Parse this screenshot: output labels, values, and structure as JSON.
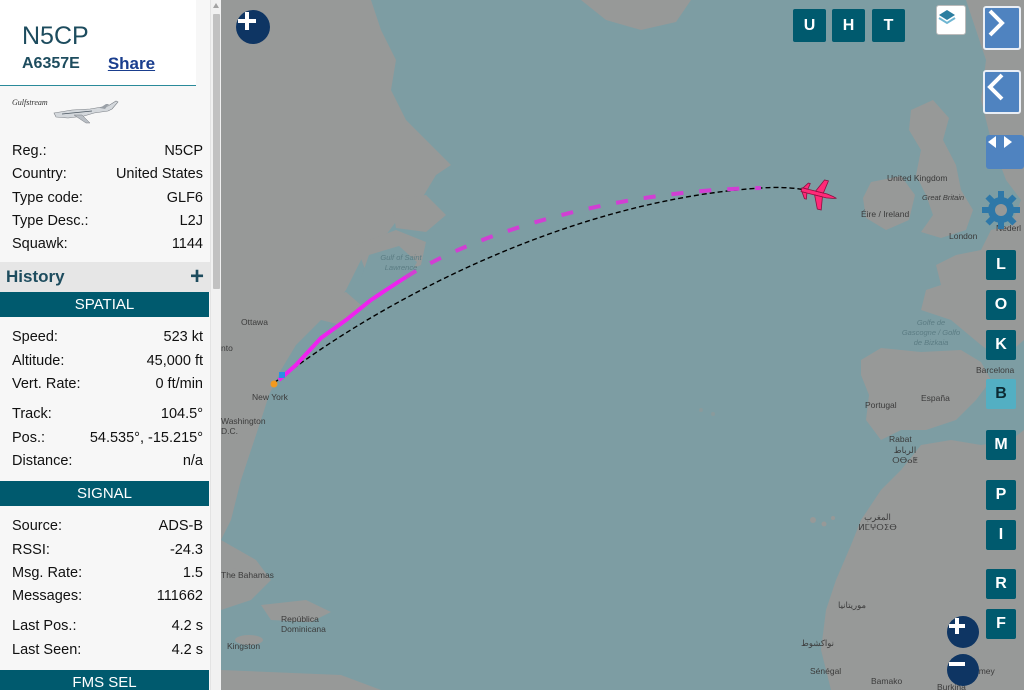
{
  "aircraft": {
    "callsign": "N5CP",
    "icao": "A6357E",
    "share_label": "Share",
    "photo_brand": "Gulfstream",
    "details": [
      {
        "label": "Reg.:",
        "value": "N5CP"
      },
      {
        "label": "Country:",
        "value": "United States"
      },
      {
        "label": "Type code:",
        "value": "GLF6"
      },
      {
        "label": "Type Desc.:",
        "value": "L2J"
      },
      {
        "label": "Squawk:",
        "value": "1144"
      }
    ]
  },
  "history": {
    "label": "History",
    "plus": "+"
  },
  "spatial": {
    "title": "SPATIAL",
    "group1": [
      {
        "label": "Speed:",
        "value": "523 kt"
      },
      {
        "label": "Altitude:",
        "value": "45,000 ft"
      },
      {
        "label": "Vert. Rate:",
        "value": "0 ft/min"
      }
    ],
    "group2": [
      {
        "label": "Track:",
        "value": "104.5°"
      },
      {
        "label": "Pos.:",
        "value": "54.535°, -15.215°"
      },
      {
        "label": "Distance:",
        "value": "n/a"
      }
    ]
  },
  "signal": {
    "title": "SIGNAL",
    "group1": [
      {
        "label": "Source:",
        "value": "ADS-B"
      },
      {
        "label": "RSSI:",
        "value": "-24.3"
      },
      {
        "label": "Msg. Rate:",
        "value": "1.5"
      },
      {
        "label": "Messages:",
        "value": "111662"
      }
    ],
    "group2": [
      {
        "label": "Last Pos.:",
        "value": "4.2 s"
      },
      {
        "label": "Last Seen:",
        "value": "4.2 s"
      }
    ]
  },
  "next_section": {
    "title": "FMS SEL"
  },
  "map": {
    "labels": {
      "united_kingdom": "United Kingdom",
      "great_britain": "Great Britain",
      "eire": "Éire / Ireland",
      "london": "London",
      "nederland": "Nederl",
      "gulf_st_lawrence": "Gulf of Saint Lawrence",
      "ottawa": "Ottawa",
      "toronto": "nto",
      "new_york": "New York",
      "washington": "Washington D.C.",
      "golfe_gascogne": "Golfe de Gascogne / Golfo de Bizkaia",
      "portugal": "Portugal",
      "espana": "España",
      "barcelona": "Barcelona",
      "rabat": "Rabat",
      "rabat_local": "الرباط ⵔⴱⴰⵟ",
      "maroc": "المغرب ⵍⵎⵖⵔⵉⴱ",
      "mauritanie": "موريتانيا",
      "nouakchott": "نواكشوط",
      "senegal": "Sénégal",
      "bamako": "Bamako",
      "burkina": "Burkina",
      "niamey": "amey",
      "bahamas": "The Bahamas",
      "republica_dominicana": "República Dominicana",
      "kingston": "Kingston"
    },
    "toggles_top": [
      "U",
      "H",
      "T"
    ],
    "toggles_side": [
      "L",
      "O",
      "K",
      "B",
      "M",
      "P",
      "I",
      "R",
      "F"
    ],
    "track_colors": {
      "line": "#000000",
      "trail": "#ee22ee",
      "plane": "#ff2a78"
    }
  }
}
